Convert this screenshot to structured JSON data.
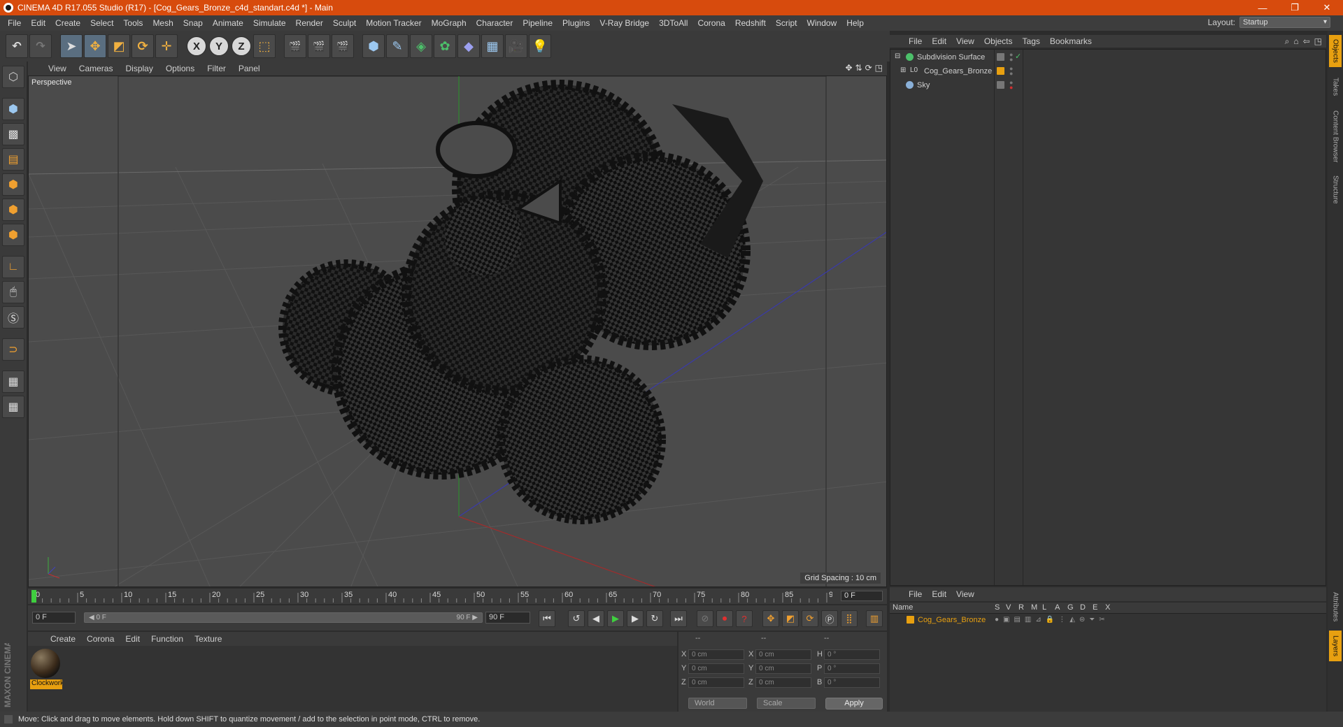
{
  "window": {
    "title": "CINEMA 4D R17.055 Studio (R17) - [Cog_Gears_Bronze_c4d_standart.c4d *] - Main",
    "min": "—",
    "max": "❐",
    "close": "✕"
  },
  "menu": [
    "File",
    "Edit",
    "Create",
    "Select",
    "Tools",
    "Mesh",
    "Snap",
    "Animate",
    "Simulate",
    "Render",
    "Sculpt",
    "Motion Tracker",
    "MoGraph",
    "Character",
    "Pipeline",
    "Plugins",
    "V-Ray Bridge",
    "3DToAll",
    "Corona",
    "Redshift",
    "Script",
    "Window",
    "Help"
  ],
  "layout": {
    "label": "Layout:",
    "value": "Startup"
  },
  "viewport": {
    "menu": [
      "View",
      "Cameras",
      "Display",
      "Options",
      "Filter",
      "Panel"
    ],
    "label": "Perspective",
    "grid_spacing": "Grid Spacing : 10 cm"
  },
  "timeline": {
    "ticks": [
      "0",
      "5",
      "10",
      "15",
      "20",
      "25",
      "30",
      "35",
      "40",
      "45",
      "50",
      "55",
      "60",
      "65",
      "70",
      "75",
      "80",
      "85",
      "90"
    ],
    "end_field": "0 F",
    "start_field": "0 F",
    "slider_left": "◀ 0 F",
    "slider_right": "90 F ▶",
    "max_field": "90 F"
  },
  "materials": {
    "menu": [
      "Create",
      "Corona",
      "Edit",
      "Function",
      "Texture"
    ],
    "item": "Clockwork"
  },
  "coords": {
    "headers": [
      "--",
      "--",
      "--"
    ],
    "rows": [
      {
        "a": "X",
        "av": "0 cm",
        "b": "X",
        "bv": "0 cm",
        "c": "H",
        "cv": "0 °"
      },
      {
        "a": "Y",
        "av": "0 cm",
        "b": "Y",
        "bv": "0 cm",
        "c": "P",
        "cv": "0 °"
      },
      {
        "a": "Z",
        "av": "0 cm",
        "b": "Z",
        "bv": "0 cm",
        "c": "B",
        "cv": "0 °"
      }
    ],
    "world": "World",
    "scale": "Scale",
    "apply": "Apply"
  },
  "objects": {
    "menu": [
      "File",
      "Edit",
      "View",
      "Objects",
      "Tags",
      "Bookmarks"
    ],
    "items": [
      {
        "name": "Subdivision Surface",
        "color": "#4cc06a"
      },
      {
        "name": "Cog_Gears_Bronze",
        "color": "#9cc8f0"
      },
      {
        "name": "Sky",
        "color": "#8ab0d8"
      }
    ]
  },
  "layers": {
    "menu": [
      "File",
      "Edit",
      "View"
    ],
    "cols": [
      "Name",
      "S",
      "V",
      "R",
      "M",
      "L",
      "A",
      "G",
      "D",
      "E",
      "X"
    ],
    "item": "Cog_Gears_Bronze",
    "item_color": "#e8a010"
  },
  "right_tabs": [
    "Objects",
    "Takes",
    "Content Browser",
    "Structure",
    "Attributes",
    "Layers"
  ],
  "status": "Move: Click and drag to move elements. Hold down SHIFT to quantize movement / add to the selection in point mode, CTRL to remove.",
  "maxon": "MAXON CINEMA 4D",
  "icons": {
    "undo": "undo-icon",
    "redo": "redo-icon",
    "select": "live-selection-icon",
    "move": "move-icon",
    "scale": "scale-icon",
    "rotate": "rotate-icon",
    "x": "X",
    "y": "Y",
    "z": "Z"
  }
}
